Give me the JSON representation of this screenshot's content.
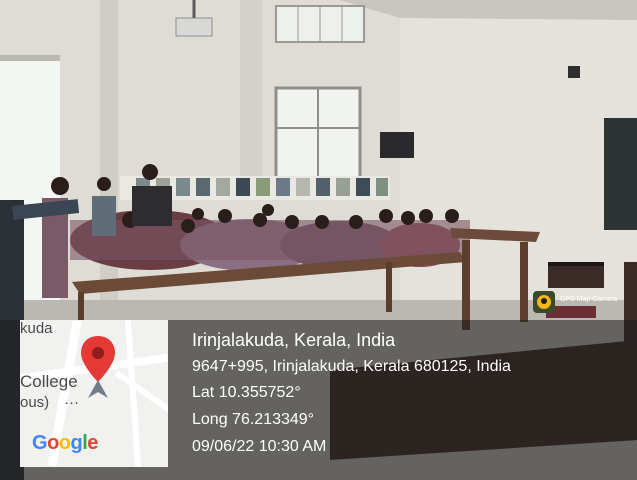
{
  "location": {
    "title": "Irinjalakuda, Kerala, India",
    "address": "9647+995, Irinjalakuda, Kerala 680125, India",
    "lat": "Lat 10.355752°",
    "long": "Long 76.213349°",
    "datetime": "09/06/22 10:30 AM"
  },
  "map": {
    "label_top": "kuda",
    "label_college": "College",
    "label_ous": "ous)",
    "logo": "Google",
    "logo_colors": [
      "#4285F4",
      "#EA4335",
      "#FBBC05",
      "#4285F4",
      "#34A853",
      "#EA4335"
    ],
    "pin_color": "#e53935"
  },
  "app": {
    "name": "GPS Map Camera",
    "icon": "gps-map-camera-icon"
  }
}
